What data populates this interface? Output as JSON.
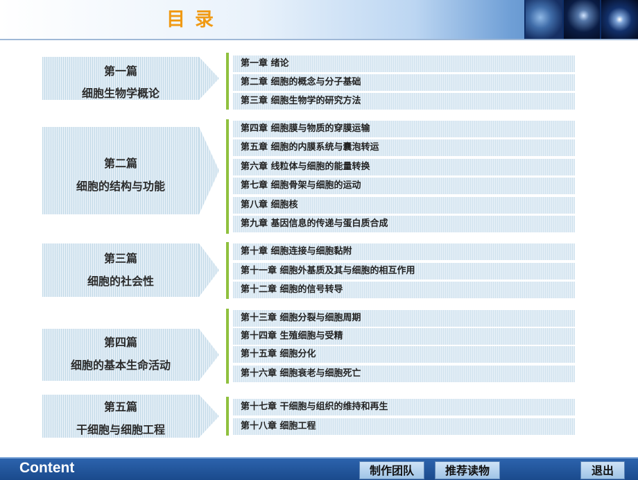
{
  "header": {
    "title": "目录"
  },
  "parts": [
    {
      "name": "第一篇",
      "title": "细胞生物学概论",
      "chapters": [
        "第一章 绪论",
        "第二章 细胞的概念与分子基础",
        "第三章 细胞生物学的研究方法"
      ]
    },
    {
      "name": "第二篇",
      "title": "细胞的结构与功能",
      "chapters": [
        "第四章 细胞膜与物质的穿膜运输",
        "第五章 细胞的内膜系统与囊泡转运",
        "第六章 线粒体与细胞的能量转换",
        "第七章 细胞骨架与细胞的运动",
        "第八章 细胞核",
        "第九章 基因信息的传递与蛋白质合成"
      ]
    },
    {
      "name": "第三篇",
      "title": "细胞的社会性",
      "chapters": [
        "第十章 细胞连接与细胞黏附",
        "第十一章 细胞外基质及其与细胞的相互作用",
        "第十二章 细胞的信号转导"
      ]
    },
    {
      "name": "第四篇",
      "title": "细胞的基本生命活动",
      "chapters": [
        "第十三章 细胞分裂与细胞周期",
        "第十四章 生殖细胞与受精",
        "第十五章 细胞分化",
        "第十六章 细胞衰老与细胞死亡"
      ]
    },
    {
      "name": "第五篇",
      "title": "干细胞与细胞工程",
      "chapters": [
        "第十七章 干细胞与组织的维持和再生",
        "第十八章 细胞工程"
      ]
    }
  ],
  "footer": {
    "label": "Content",
    "team_button": "制作团队",
    "reading_button": "推荐读物",
    "exit_button": "退出"
  }
}
